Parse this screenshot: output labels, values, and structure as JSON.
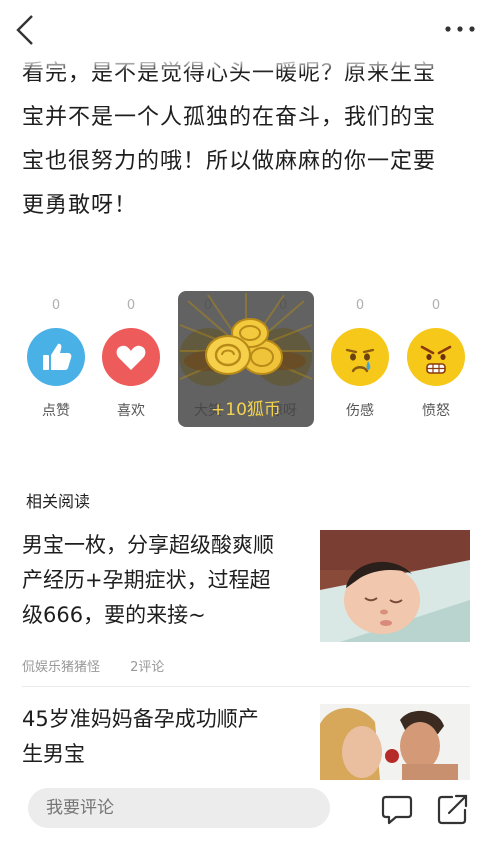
{
  "article": {
    "lines": [
      "看完，是不是觉得心头一暖呢？原来生宝",
      "宝并不是一个人孤独的在奋斗，我们的宝",
      "宝也很努力的哦！所以做麻麻的你一定要",
      "更勇敢呀！"
    ]
  },
  "reactions": [
    {
      "name": "like",
      "label": "点赞",
      "count": "0",
      "color": "#4ab1e6",
      "icon": "thumbs-up-icon"
    },
    {
      "name": "love",
      "label": "喜欢",
      "count": "0",
      "color": "#ee5b5b",
      "icon": "heart-icon"
    },
    {
      "name": "big",
      "label": "大笑",
      "count": "0",
      "color": "#f6c81a",
      "icon": "laugh-icon"
    },
    {
      "name": "wow",
      "label": "惊呀",
      "count": "0",
      "color": "#f6c81a",
      "icon": "surprised-icon"
    },
    {
      "name": "sad",
      "label": "伤感",
      "count": "0",
      "color": "#f6c81a",
      "icon": "crying-face-icon"
    },
    {
      "name": "angry",
      "label": "愤怒",
      "count": "0",
      "color": "#f6c81a",
      "icon": "angry-face-icon"
    }
  ],
  "coin_popup": {
    "text": "+10狐币",
    "icon": "gold-coins-icon"
  },
  "related": {
    "title": "相关阅读",
    "items": [
      {
        "title_lines": [
          "男宝一枚，分享超级酸爽顺",
          "产经历+孕期症状，过程超",
          "级666，要的来接~"
        ],
        "author": "侃娱乐猪猪怪",
        "comments": "2评论"
      },
      {
        "title_lines": [
          "45岁准妈妈备孕成功顺产",
          "生男宝"
        ]
      }
    ]
  },
  "bottom": {
    "comment_placeholder": "我要评论"
  }
}
